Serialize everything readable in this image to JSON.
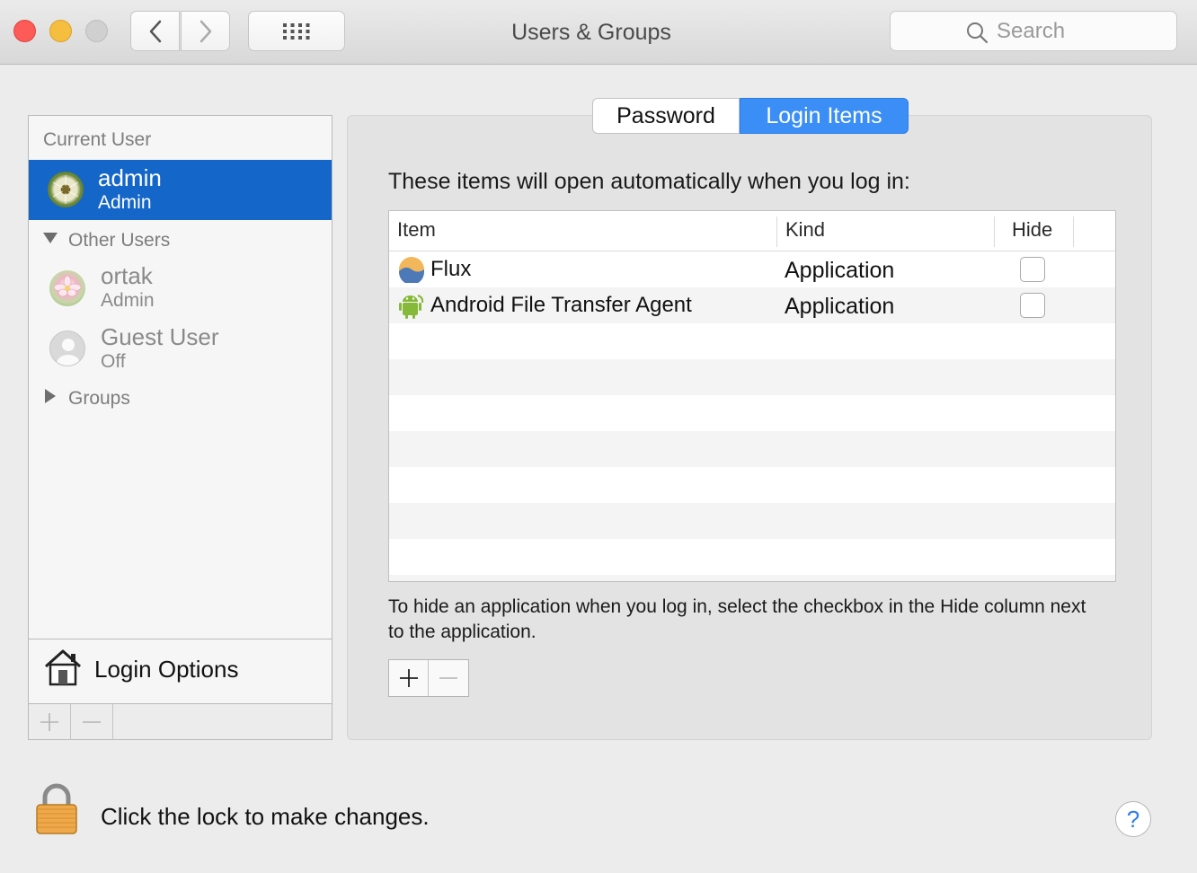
{
  "window": {
    "title": "Users & Groups"
  },
  "search": {
    "placeholder": "Search"
  },
  "sidebar": {
    "current_user_label": "Current User",
    "current_user": {
      "name": "admin",
      "role": "Admin"
    },
    "other_users_label": "Other Users",
    "other_users": [
      {
        "name": "ortak",
        "role": "Admin"
      },
      {
        "name": "Guest User",
        "role": "Off"
      }
    ],
    "groups_label": "Groups",
    "login_options_label": "Login Options"
  },
  "tabs": {
    "password": "Password",
    "login_items": "Login Items",
    "selected": "Login Items"
  },
  "login_items": {
    "intro": "These items will open automatically when you log in:",
    "columns": {
      "item": "Item",
      "kind": "Kind",
      "hide": "Hide"
    },
    "rows": [
      {
        "name": "Flux",
        "kind": "Application",
        "hide": false,
        "icon": "flux-icon"
      },
      {
        "name": "Android File Transfer Agent",
        "kind": "Application",
        "hide": false,
        "icon": "android-icon"
      }
    ],
    "hint": "To hide an application when you log in, select the checkbox in the Hide column next to the application."
  },
  "footer": {
    "lock_text": "Click the lock to make changes.",
    "help": "?"
  },
  "colors": {
    "selection": "#1466c8",
    "accent": "#3a8ef6"
  }
}
